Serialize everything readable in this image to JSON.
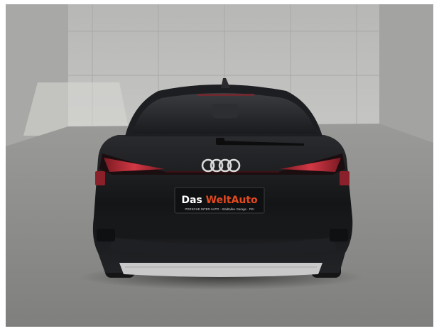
{
  "photo": {
    "subject": "Audi car rear view",
    "license_plate": {
      "brand_part1": "Das ",
      "brand_part2": "WeltAuto",
      "dealer_line": "PORSCHE INTER AUTO · Stadtallee Garage · PKI"
    },
    "colors": {
      "wall": "#bdbdbb",
      "floor": "#8f8f8d",
      "car_body": "#1a1b1d",
      "taillight": "#c8323c",
      "diffuser": "#c9c9c9",
      "plate_accent": "#e34a1f"
    }
  }
}
